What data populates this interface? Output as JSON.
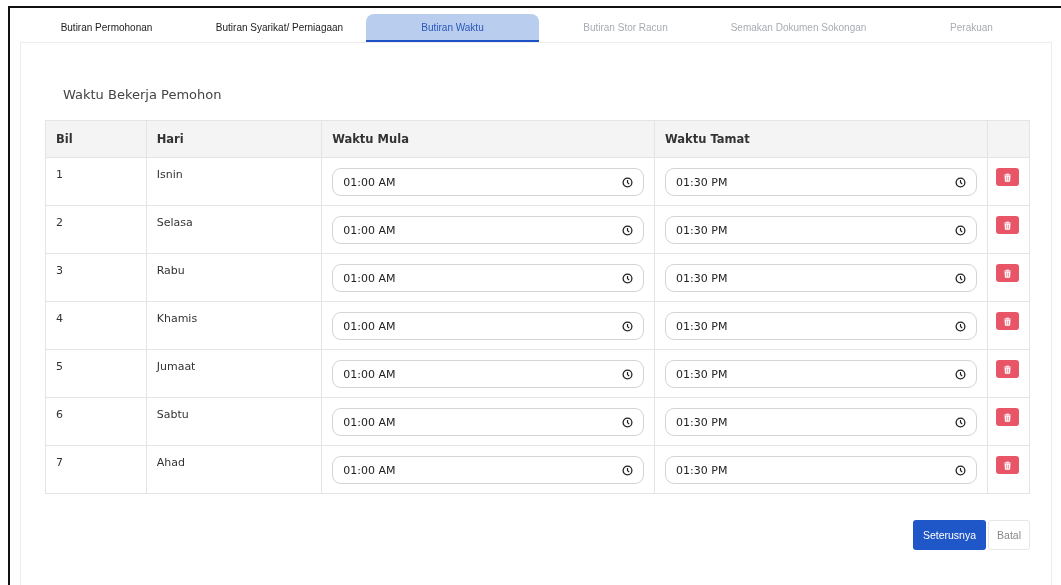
{
  "tabs": [
    {
      "label": "Butiran Permohonan",
      "selected": false,
      "disabled": false
    },
    {
      "label": "Butiran Syarikat/ Perniagaan",
      "selected": false,
      "disabled": false
    },
    {
      "label": "Butiran Waktu",
      "selected": true,
      "disabled": false
    },
    {
      "label": "Butiran Stor Racun",
      "selected": false,
      "disabled": true
    },
    {
      "label": "Semakan Dokumen Sokongan",
      "selected": false,
      "disabled": true
    },
    {
      "label": "Perakuan",
      "selected": false,
      "disabled": true
    }
  ],
  "section_title": "Waktu Bekerja Pemohon",
  "table": {
    "columns": [
      "Bil",
      "Hari",
      "Waktu Mula",
      "Waktu Tamat"
    ],
    "rows": [
      {
        "bil": "1",
        "hari": "Isnin",
        "mula": "01:00 AM",
        "tamat": "01:30 PM"
      },
      {
        "bil": "2",
        "hari": "Selasa",
        "mula": "01:00 AM",
        "tamat": "01:30 PM"
      },
      {
        "bil": "3",
        "hari": "Rabu",
        "mula": "01:00 AM",
        "tamat": "01:30 PM"
      },
      {
        "bil": "4",
        "hari": "Khamis",
        "mula": "01:00 AM",
        "tamat": "01:30 PM"
      },
      {
        "bil": "5",
        "hari": "Jumaat",
        "mula": "01:00 AM",
        "tamat": "01:30 PM"
      },
      {
        "bil": "6",
        "hari": "Sabtu",
        "mula": "01:00 AM",
        "tamat": "01:30 PM"
      },
      {
        "bil": "7",
        "hari": "Ahad",
        "mula": "01:00 AM",
        "tamat": "01:30 PM"
      }
    ]
  },
  "buttons": {
    "next": "Seterusnya",
    "cancel": "Batal"
  }
}
